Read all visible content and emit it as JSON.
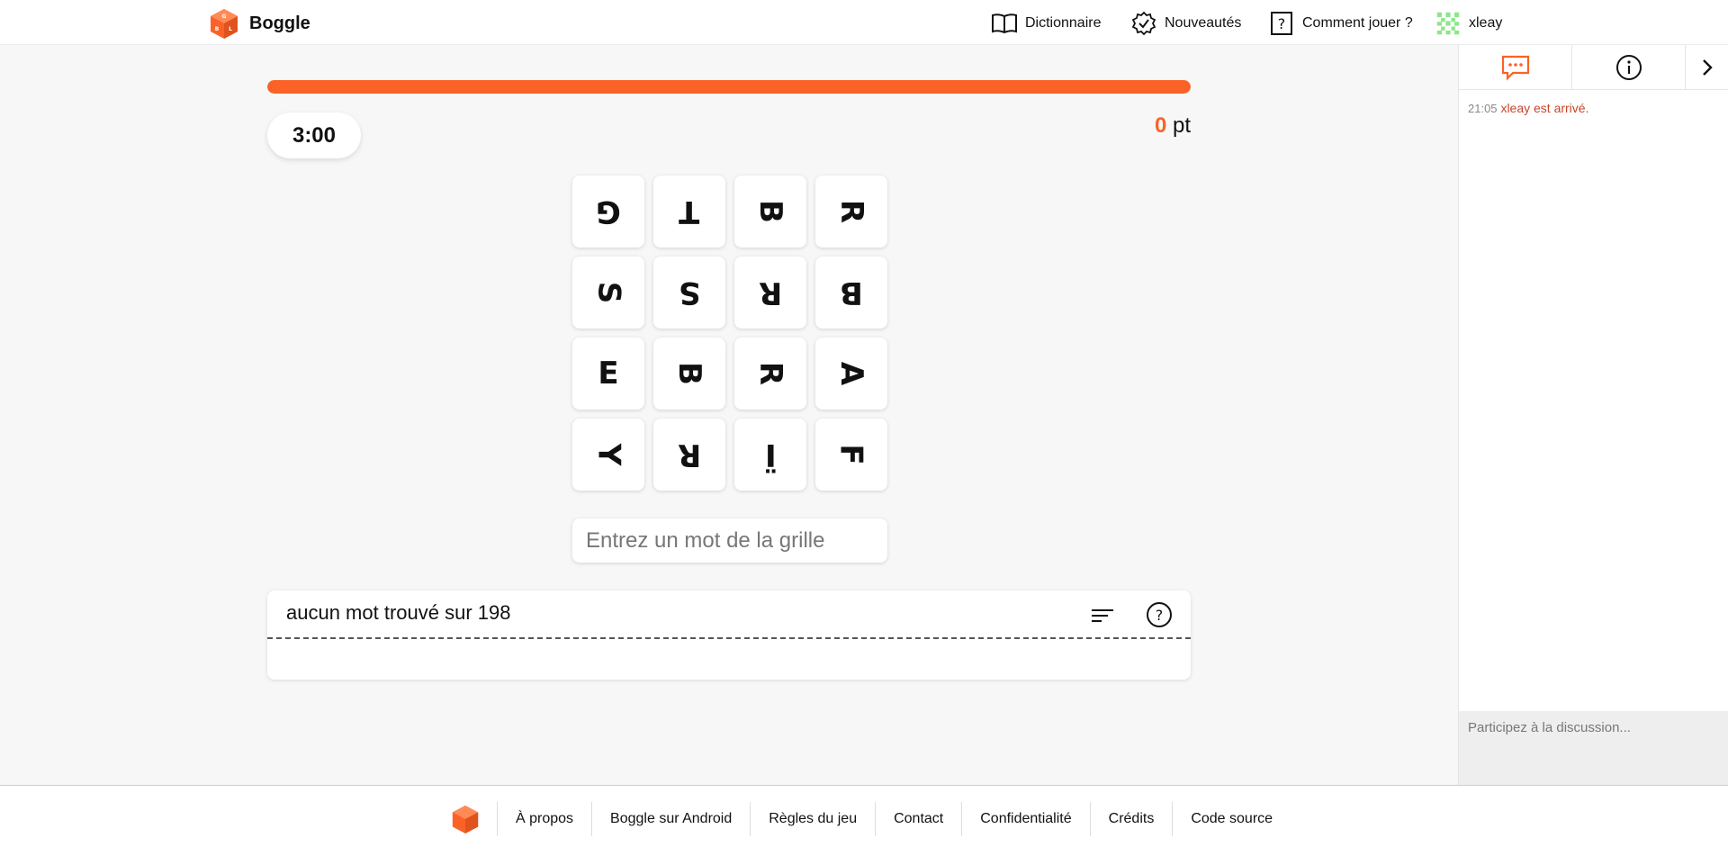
{
  "header": {
    "brand": "Boggle",
    "nav": {
      "dictionary": "Dictionnaire",
      "news": "Nouveautés",
      "how_to_play": "Comment jouer ?",
      "user": "xleay"
    }
  },
  "game": {
    "progress_fraction": 1.0,
    "timer": "3:00",
    "score_value": "0",
    "score_unit": "pt",
    "grid": [
      {
        "letter": "G",
        "rotation": 180
      },
      {
        "letter": "T",
        "rotation": 180
      },
      {
        "letter": "B",
        "rotation": 90
      },
      {
        "letter": "R",
        "rotation": 90
      },
      {
        "letter": "S",
        "rotation": 90
      },
      {
        "letter": "S",
        "rotation": 180
      },
      {
        "letter": "R",
        "rotation": 180
      },
      {
        "letter": "B",
        "rotation": 180
      },
      {
        "letter": "E",
        "rotation": 0
      },
      {
        "letter": "B",
        "rotation": 90
      },
      {
        "letter": "R",
        "rotation": 90
      },
      {
        "letter": "A",
        "rotation": 90
      },
      {
        "letter": "Y",
        "rotation": 90
      },
      {
        "letter": "R",
        "rotation": 180
      },
      {
        "letter": "Ï",
        "rotation": 180
      },
      {
        "letter": "F",
        "rotation": 90
      }
    ],
    "input_placeholder": "Entrez un mot de la grille",
    "found_words_summary": "aucun mot trouvé sur 198"
  },
  "sidebar": {
    "chat_messages": [
      {
        "time": "21:05",
        "text": "xleay est arrivé."
      }
    ],
    "chat_placeholder": "Participez à la discussion..."
  },
  "footer": {
    "links": [
      "À propos",
      "Boggle sur Android",
      "Règles du jeu",
      "Contact",
      "Confidentialité",
      "Crédits",
      "Code source"
    ]
  },
  "colors": {
    "accent": "#fb6227",
    "chat_text": "#c7462a"
  },
  "icons": [
    "boggle-cube-logo",
    "book-icon",
    "badge-check-icon",
    "question-box-icon",
    "user-avatar",
    "sort-icon",
    "help-circle-icon",
    "chat-icon",
    "info-icon",
    "chevron-right-icon"
  ]
}
